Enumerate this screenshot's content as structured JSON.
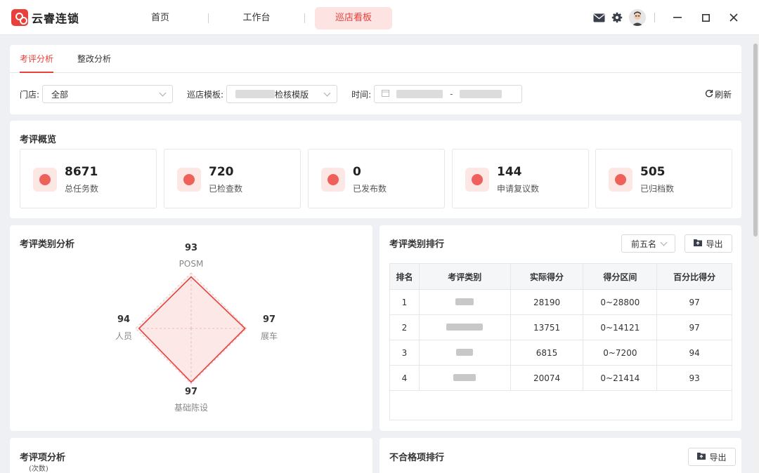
{
  "app": {
    "name": "云睿连锁"
  },
  "nav": {
    "items": [
      "首页",
      "工作台",
      "巡店看板"
    ],
    "active_index": 2
  },
  "colors": {
    "accent": "#e8403b",
    "accent_light": "#fde3e1"
  },
  "filter_bar": {
    "tabs": [
      "考评分析",
      "整改分析"
    ],
    "active_tab": 0,
    "store_label": "门店:",
    "store_value": "全部",
    "template_label": "巡店模板:",
    "template_value": "检核模版",
    "time_label": "时间:",
    "time_separator": "-",
    "refresh_label": "刷新"
  },
  "overview": {
    "title": "考评概览",
    "stats": [
      {
        "value": "8671",
        "label": "总任务数",
        "icon": "task-icon"
      },
      {
        "value": "720",
        "label": "已检查数",
        "icon": "check-icon"
      },
      {
        "value": "0",
        "label": "已发布数",
        "icon": "publish-icon"
      },
      {
        "value": "144",
        "label": "申请复议数",
        "icon": "appeal-icon"
      },
      {
        "value": "505",
        "label": "已归档数",
        "icon": "archive-icon"
      }
    ]
  },
  "category_analysis": {
    "title": "考评类别分析",
    "chart_data": {
      "type": "radar",
      "categories": [
        "POSM",
        "展车",
        "基础陈设",
        "人员"
      ],
      "values": [
        93,
        97,
        97,
        94
      ],
      "max": 100
    }
  },
  "category_rank": {
    "title": "考评类别排行",
    "select_value": "前五名",
    "export_label": "导出",
    "columns": [
      "排名",
      "考评类别",
      "实际得分",
      "得分区间",
      "百分比得分"
    ],
    "rows": [
      {
        "rank": "1",
        "score": "28190",
        "range": "0~28800",
        "percent": "97"
      },
      {
        "rank": "2",
        "score": "13751",
        "range": "0~14121",
        "percent": "97"
      },
      {
        "rank": "3",
        "score": "6815",
        "range": "0~7200",
        "percent": "94"
      },
      {
        "rank": "4",
        "score": "20074",
        "range": "0~21414",
        "percent": "93"
      }
    ]
  },
  "item_analysis": {
    "title": "考评项分析",
    "unit": "(次数)"
  },
  "fail_rank": {
    "title": "不合格项排行",
    "export_label": "导出"
  }
}
